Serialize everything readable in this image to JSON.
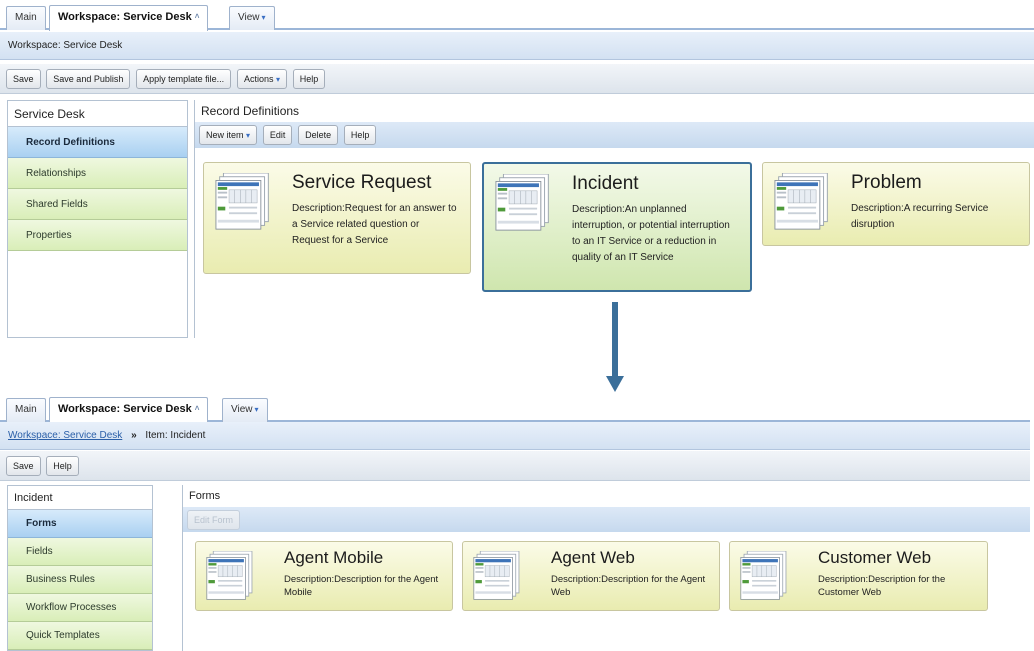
{
  "top": {
    "tabs": [
      {
        "label": "Main"
      },
      {
        "label": "Workspace: Service Desk",
        "close": "˄"
      },
      {
        "label": "View",
        "caret": "▾"
      }
    ],
    "title": "Workspace: Service Desk",
    "toolbar": {
      "save": "Save",
      "save_publish": "Save and Publish",
      "apply_template": "Apply template file...",
      "actions": "Actions",
      "help": "Help"
    },
    "sidebar": {
      "header": "Service Desk",
      "items": [
        {
          "label": "Record Definitions"
        },
        {
          "label": "Relationships"
        },
        {
          "label": "Shared Fields"
        },
        {
          "label": "Properties"
        }
      ]
    },
    "content": {
      "header": "Record Definitions",
      "toolbar": {
        "new_item": "New item",
        "edit": "Edit",
        "delete": "Delete",
        "help": "Help"
      },
      "cards": [
        {
          "title": "Service Request",
          "description": "Description:Request for an answer to a Service related question or Request for a Service"
        },
        {
          "title": "Incident",
          "description": "Description:An unplanned interruption, or potential interruption to an IT Service or a reduction in quality of an IT Service"
        },
        {
          "title": "Problem",
          "description": "Description:A recurring Service disruption"
        }
      ]
    }
  },
  "bottom": {
    "tabs": [
      {
        "label": "Main"
      },
      {
        "label": "Workspace: Service Desk",
        "close": "˄"
      },
      {
        "label": "View",
        "caret": "▾"
      }
    ],
    "breadcrumb": {
      "link": "Workspace: Service Desk",
      "separator": "»",
      "current": "Item: Incident"
    },
    "toolbar": {
      "save": "Save",
      "help": "Help"
    },
    "sidebar": {
      "header": "Incident",
      "items": [
        {
          "label": "Forms"
        },
        {
          "label": "Fields"
        },
        {
          "label": "Business Rules"
        },
        {
          "label": "Workflow Processes"
        },
        {
          "label": "Quick Templates"
        }
      ]
    },
    "content": {
      "header": "Forms",
      "toolbar": {
        "edit_form": "Edit Form"
      },
      "cards": [
        {
          "title": "Agent Mobile",
          "description": "Description:Description for the Agent Mobile"
        },
        {
          "title": "Agent Web",
          "description": "Description:Description for the Agent Web"
        },
        {
          "title": "Customer Web",
          "description": "Description:Description for the Customer Web"
        }
      ]
    }
  },
  "icons": {
    "record_thumbnail": "form-thumbnail-icon",
    "flow_arrow": "down-arrow-icon"
  },
  "colors": {
    "accent_blue": "#3b6f9a",
    "card_yellow": "#e9ecb0",
    "card_green": "#cfe6ae",
    "nav_green": "#d9eeb8",
    "nav_selected": "#a9d0f1"
  }
}
